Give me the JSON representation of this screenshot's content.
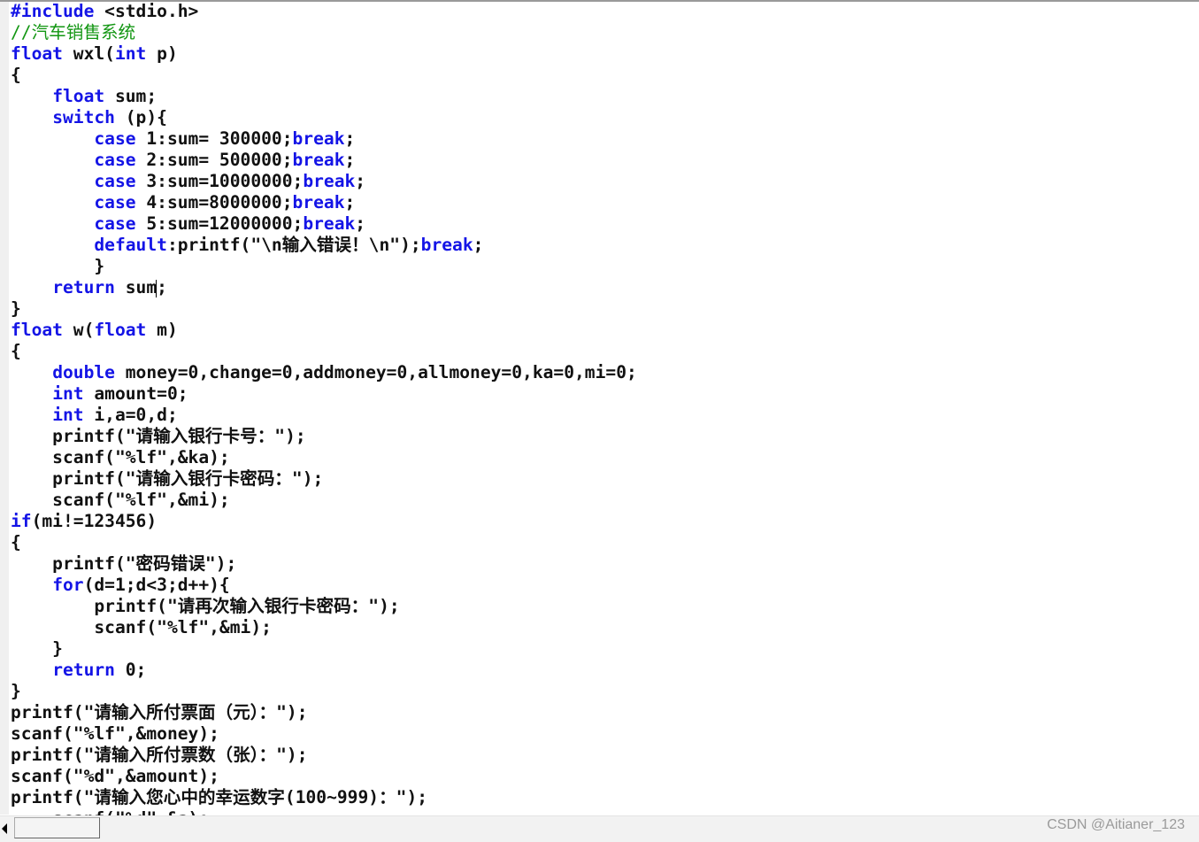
{
  "colors": {
    "keyword": "#1414e6",
    "comment": "#129612",
    "text": "#111111"
  },
  "watermark": "CSDN @Aitianer_123",
  "caret_line": 13,
  "lines": [
    [
      [
        "k",
        "#include"
      ],
      [
        "n",
        " <stdio.h>"
      ]
    ],
    [
      [
        "c",
        "//汽车销售系统"
      ]
    ],
    [
      [
        "k",
        "float"
      ],
      [
        "n",
        " wxl("
      ],
      [
        "k",
        "int"
      ],
      [
        "n",
        " p)"
      ]
    ],
    [
      [
        "n",
        "{"
      ]
    ],
    [
      [
        "n",
        "    "
      ],
      [
        "k",
        "float"
      ],
      [
        "n",
        " sum;"
      ]
    ],
    [
      [
        "n",
        "    "
      ],
      [
        "k",
        "switch"
      ],
      [
        "n",
        " (p){"
      ]
    ],
    [
      [
        "n",
        "        "
      ],
      [
        "k",
        "case"
      ],
      [
        "n",
        " 1:sum= 300000;"
      ],
      [
        "k",
        "break"
      ],
      [
        "n",
        ";"
      ]
    ],
    [
      [
        "n",
        "        "
      ],
      [
        "k",
        "case"
      ],
      [
        "n",
        " 2:sum= 500000;"
      ],
      [
        "k",
        "break"
      ],
      [
        "n",
        ";"
      ]
    ],
    [
      [
        "n",
        "        "
      ],
      [
        "k",
        "case"
      ],
      [
        "n",
        " 3:sum=10000000;"
      ],
      [
        "k",
        "break"
      ],
      [
        "n",
        ";"
      ]
    ],
    [
      [
        "n",
        "        "
      ],
      [
        "k",
        "case"
      ],
      [
        "n",
        " 4:sum=8000000;"
      ],
      [
        "k",
        "break"
      ],
      [
        "n",
        ";"
      ]
    ],
    [
      [
        "n",
        "        "
      ],
      [
        "k",
        "case"
      ],
      [
        "n",
        " 5:sum=12000000;"
      ],
      [
        "k",
        "break"
      ],
      [
        "n",
        ";"
      ]
    ],
    [
      [
        "n",
        "        "
      ],
      [
        "k",
        "default"
      ],
      [
        "n",
        ":printf(\"\\n输入错误！\\n\");"
      ],
      [
        "k",
        "break"
      ],
      [
        "n",
        ";"
      ]
    ],
    [
      [
        "n",
        "        }"
      ]
    ],
    [
      [
        "n",
        "    "
      ],
      [
        "k",
        "return"
      ],
      [
        "n",
        " sum"
      ],
      [
        "caret",
        ""
      ],
      [
        "n",
        ";"
      ]
    ],
    [
      [
        "n",
        "}"
      ]
    ],
    [
      [
        "k",
        "float"
      ],
      [
        "n",
        " w("
      ],
      [
        "k",
        "float"
      ],
      [
        "n",
        " m)"
      ]
    ],
    [
      [
        "n",
        "{"
      ]
    ],
    [
      [
        "n",
        "    "
      ],
      [
        "k",
        "double"
      ],
      [
        "n",
        " money=0,change=0,addmoney=0,allmoney=0,ka=0,mi=0;"
      ]
    ],
    [
      [
        "n",
        "    "
      ],
      [
        "k",
        "int"
      ],
      [
        "n",
        " amount=0;"
      ]
    ],
    [
      [
        "n",
        "    "
      ],
      [
        "k",
        "int"
      ],
      [
        "n",
        " i,a=0,d;"
      ]
    ],
    [
      [
        "n",
        "    printf(\"请输入银行卡号：\");"
      ]
    ],
    [
      [
        "n",
        "    scanf(\"%lf\",&ka);"
      ]
    ],
    [
      [
        "n",
        "    printf(\"请输入银行卡密码：\");"
      ]
    ],
    [
      [
        "n",
        "    scanf(\"%lf\",&mi);"
      ]
    ],
    [
      [
        "k",
        "if"
      ],
      [
        "n",
        "(mi!=123456)"
      ]
    ],
    [
      [
        "n",
        "{"
      ]
    ],
    [
      [
        "n",
        "    printf(\"密码错误\");"
      ]
    ],
    [
      [
        "n",
        "    "
      ],
      [
        "k",
        "for"
      ],
      [
        "n",
        "(d=1;d<3;d++){"
      ]
    ],
    [
      [
        "n",
        "        printf(\"请再次输入银行卡密码：\");"
      ]
    ],
    [
      [
        "n",
        "        scanf(\"%lf\",&mi);"
      ]
    ],
    [
      [
        "n",
        "    }"
      ]
    ],
    [
      [
        "n",
        "    "
      ],
      [
        "k",
        "return"
      ],
      [
        "n",
        " 0;"
      ]
    ],
    [
      [
        "n",
        "}"
      ]
    ],
    [
      [
        "n",
        "printf(\"请输入所付票面（元）：\");"
      ]
    ],
    [
      [
        "n",
        "scanf(\"%lf\",&money);"
      ]
    ],
    [
      [
        "n",
        "printf(\"请输入所付票数（张）：\");"
      ]
    ],
    [
      [
        "n",
        "scanf(\"%d\",&amount);"
      ]
    ],
    [
      [
        "n",
        "printf(\"请输入您心中的幸运数字(100~999)：\");"
      ]
    ],
    [
      [
        "n",
        "    scanf(\"%d\",&a);"
      ]
    ]
  ]
}
